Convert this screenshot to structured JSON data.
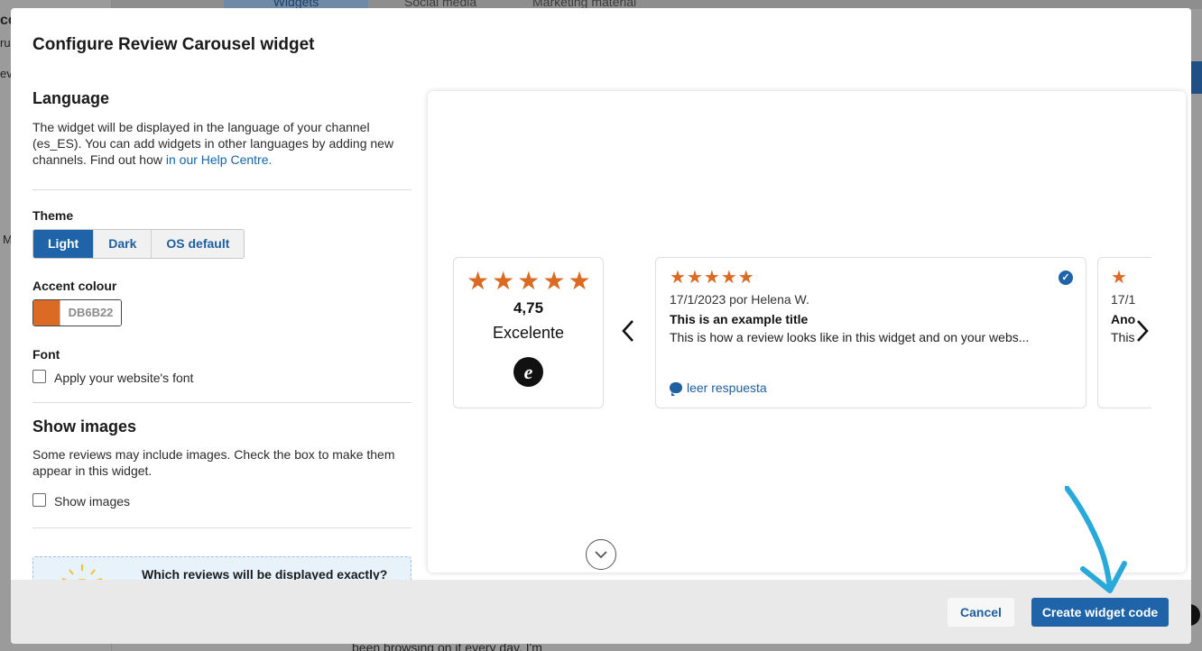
{
  "background": {
    "tabs": [
      "Widgets",
      "Social media",
      "Marketing material"
    ],
    "left_fragments": [
      "cc",
      "ru",
      "evi",
      "M"
    ],
    "bottom_text": "been browsing on it every day. I'm"
  },
  "modal": {
    "title": "Configure Review Carousel widget",
    "language": {
      "heading": "Language",
      "text": "The widget will be displayed in the language of your channel (es_ES). You can add widgets in other languages by adding new channels. Find out how ",
      "link": "in our Help Centre."
    },
    "theme": {
      "label": "Theme",
      "options": [
        "Light",
        "Dark",
        "OS default"
      ],
      "selected": "Light"
    },
    "accent": {
      "label": "Accent colour",
      "hex": "DB6B22",
      "color": "#DB6B22"
    },
    "font": {
      "label": "Font",
      "checkbox_label": "Apply your website's font",
      "checked": false
    },
    "images": {
      "heading": "Show images",
      "text": "Some reviews may include images. Check the box to make them appear in this widget.",
      "checkbox_label": "Show images",
      "checked": false
    },
    "info": {
      "title": "Which reviews will be displayed exactly?"
    },
    "footer": {
      "cancel_label": "Cancel",
      "create_label": "Create widget code"
    }
  },
  "preview": {
    "summary": {
      "stars": 5,
      "rating": "4,75",
      "rating_word": "Excelente",
      "logo_glyph": "e"
    },
    "review": {
      "stars": 5,
      "date_author": "17/1/2023 por Helena W.",
      "title": "This is an example title",
      "body": "This is how a review looks like in this widget and on your webs...",
      "reply_label": "leer respuesta",
      "verified_glyph": "✓"
    },
    "peek": {
      "date": "17/1",
      "title": "Ano",
      "body": "This"
    },
    "prev_glyph": "‹",
    "next_glyph": "›",
    "scroll_glyph": "⌄",
    "star_glyph": "★"
  },
  "colors": {
    "primary": "#1f64a8",
    "star": "#DB6B22",
    "annotation": "#29a9d9"
  }
}
